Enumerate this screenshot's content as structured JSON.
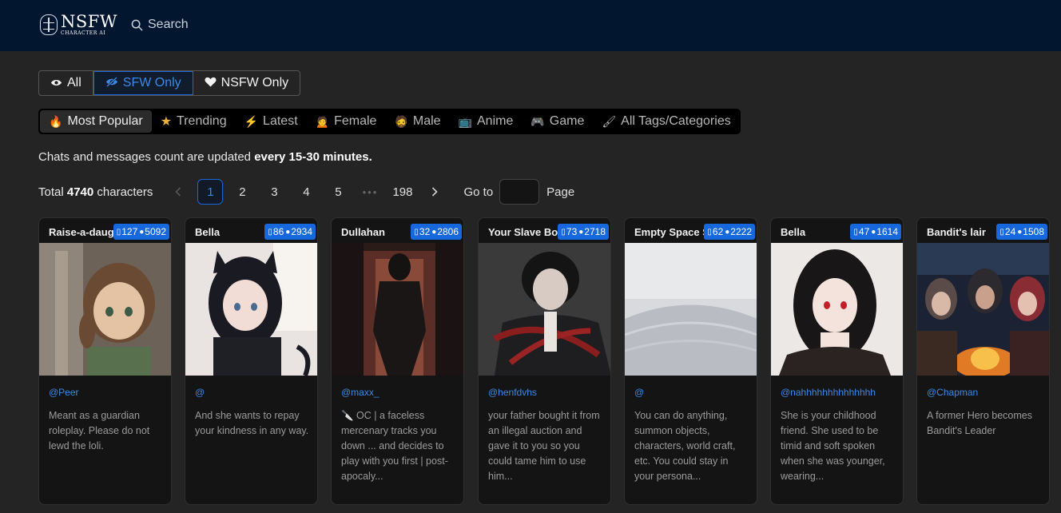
{
  "header": {
    "logo_main": "NSFW",
    "logo_sub": "CHARACTER AI",
    "search_label": "Search"
  },
  "filter": [
    {
      "label": "All",
      "icon": "eye-icon"
    },
    {
      "label": "SFW Only",
      "icon": "eye-slash-icon",
      "active": true
    },
    {
      "label": "NSFW Only",
      "icon": "heart-icon"
    }
  ],
  "tabs": [
    {
      "label": "Most Popular",
      "icon": "fire-icon",
      "glyph": "🔥",
      "active": true
    },
    {
      "label": "Trending",
      "icon": "star-icon",
      "glyph": "★"
    },
    {
      "label": "Latest",
      "icon": "lightning-icon",
      "glyph": "⚡"
    },
    {
      "label": "Female",
      "icon": "female-face-icon",
      "glyph": "🙍"
    },
    {
      "label": "Male",
      "icon": "male-face-icon",
      "glyph": "🧔"
    },
    {
      "label": "Anime",
      "icon": "tv-icon",
      "glyph": "📺"
    },
    {
      "label": "Game",
      "icon": "gamepad-icon",
      "glyph": "🎮"
    },
    {
      "label": "All Tags/Categories",
      "icon": "brush-icon",
      "glyph": "🖌"
    }
  ],
  "note": {
    "text": "Chats and messages count are updated ",
    "bold": "every 15-30 minutes."
  },
  "pagination": {
    "total_prefix": "Total ",
    "total_count": "4740",
    "total_suffix": " characters",
    "pages": [
      "1",
      "2",
      "3",
      "4",
      "5"
    ],
    "ellipsis": "•••",
    "last_page": "198",
    "goto_label": "Go to",
    "page_label": "Page"
  },
  "cards": [
    {
      "name": "Raise-a-daughter",
      "chats": "127",
      "messages": "5092",
      "author": "@Peer",
      "desc": "Meant as a guardian roleplay. Please do not lewd the loli."
    },
    {
      "name": "Bella",
      "chats": "86",
      "messages": "2934",
      "author": "@",
      "desc": "And she wants to repay your kindness in any way."
    },
    {
      "name": "Dullahan",
      "chats": "32",
      "messages": "2806",
      "author": "@maxx_",
      "desc": "🔪 OC | a faceless mercenary tracks you down ... and decides to play with you first | post-apocaly..."
    },
    {
      "name": "Your Slave Boy",
      "chats": "73",
      "messages": "2718",
      "author": "@henfdvhs",
      "desc": "your father bought it from an illegal auction and gave it to you so you could tame him to use him..."
    },
    {
      "name": "Empty Space Simulator",
      "chats": "62",
      "messages": "2222",
      "author": "@",
      "desc": "You can do anything, summon objects, characters, world craft, etc. You could stay in your persona..."
    },
    {
      "name": "Bella",
      "chats": "47",
      "messages": "1614",
      "author": "@nahhhhhhhhhhhhhh",
      "desc": "She is your childhood friend. She used to be timid and soft spoken when she was younger, wearing..."
    },
    {
      "name": "Bandit's lair",
      "chats": "24",
      "messages": "1508",
      "author": "@Chapman",
      "desc": "A former Hero becomes Bandit's Leader"
    }
  ]
}
